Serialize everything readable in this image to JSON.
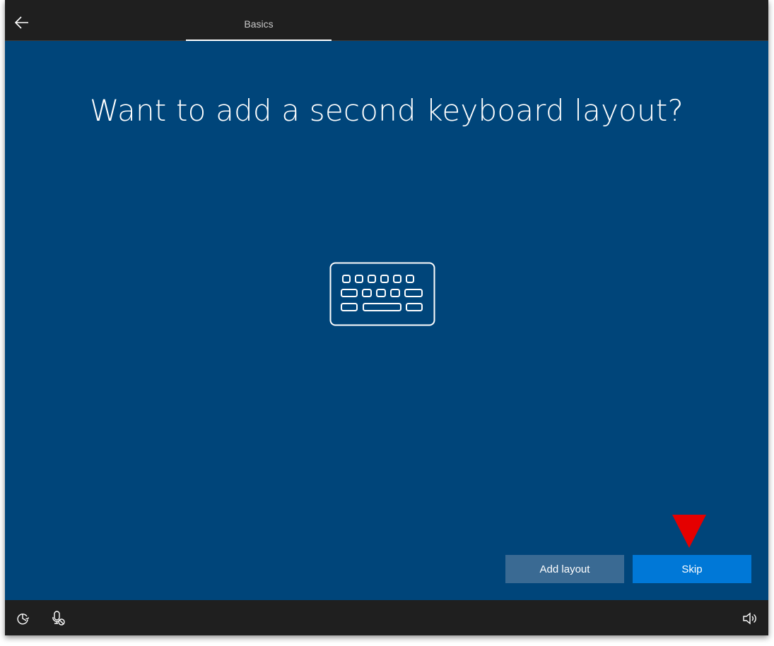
{
  "header": {
    "back_icon": "arrow-left-icon",
    "tab_label": "Basics"
  },
  "main": {
    "title": "Want to add a second keyboard layout?",
    "illustration_icon": "keyboard-icon",
    "pointer_marker_color": "#e50000"
  },
  "actions": {
    "add_layout_label": "Add layout",
    "skip_label": "Skip"
  },
  "footer": {
    "left_icons": [
      "ease-of-access-icon",
      "microphone-muted-icon"
    ],
    "right_icon": "volume-icon"
  },
  "colors": {
    "background": "#00457a",
    "bars": "#1f1f1f",
    "primary_button": "#0078d7",
    "secondary_button": "#3a6a93"
  }
}
